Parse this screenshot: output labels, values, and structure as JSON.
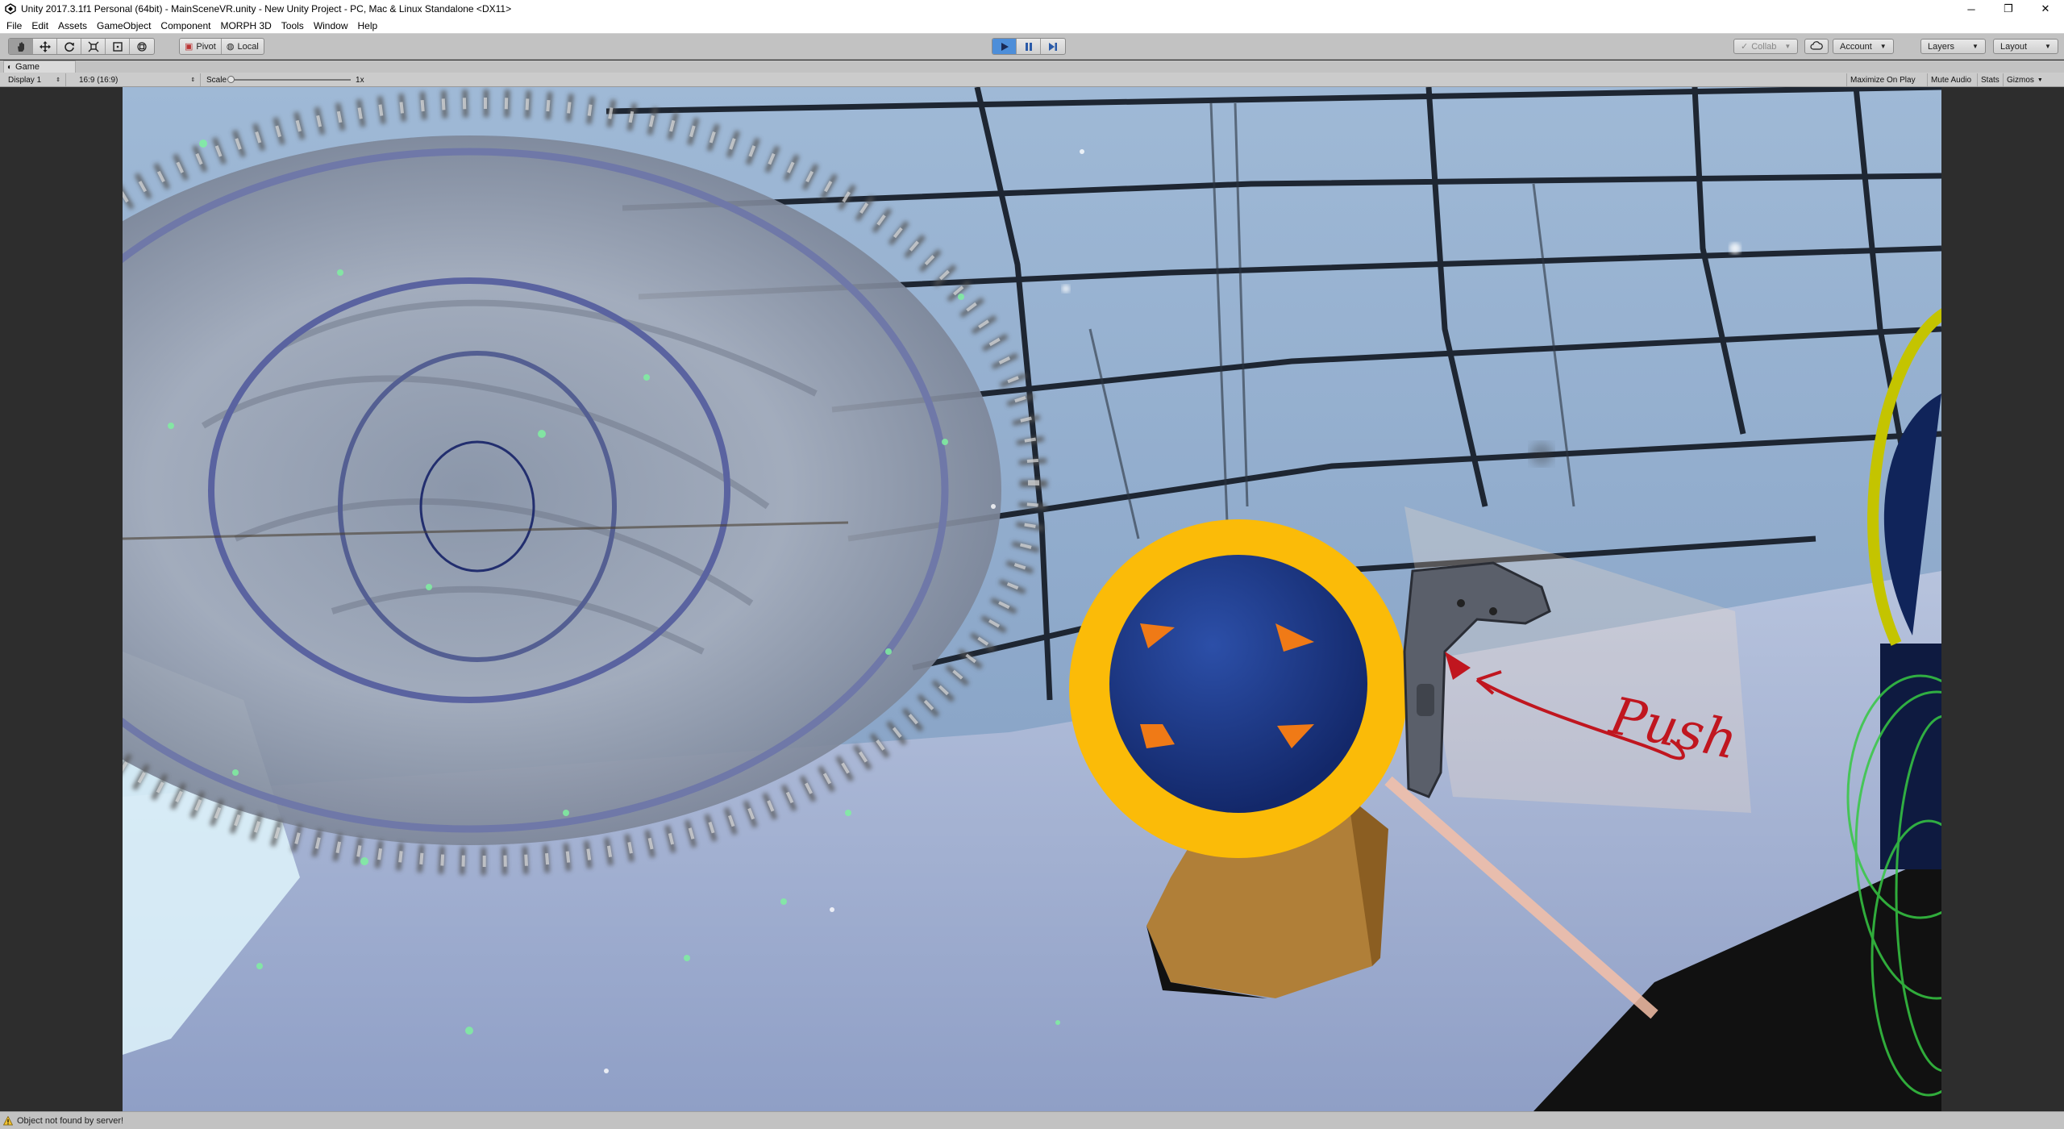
{
  "window": {
    "title": "Unity 2017.3.1f1 Personal (64bit) - MainSceneVR.unity - New Unity Project - PC, Mac & Linux Standalone <DX11>",
    "minimize": "─",
    "restore": "❐",
    "close": "✕"
  },
  "menu": [
    "File",
    "Edit",
    "Assets",
    "GameObject",
    "Component",
    "MORPH 3D",
    "Tools",
    "Window",
    "Help"
  ],
  "toolbar": {
    "pivot_label": "Pivot",
    "local_label": "Local",
    "collab_label": "Collab",
    "account_label": "Account",
    "layers_label": "Layers",
    "layout_label": "Layout"
  },
  "game_tab": {
    "label": "Game"
  },
  "game_controls": {
    "display": "Display 1",
    "aspect": "16:9 (16:9)",
    "scale_label": "Scale",
    "scale_value": "1x",
    "maximize_on_play": "Maximize On Play",
    "mute_audio": "Mute Audio",
    "stats": "Stats",
    "gizmos": "Gizmos"
  },
  "scene": {
    "annotation_text": "Push",
    "annotation_color": "#c0161f",
    "button_ring_color": "#fbbb08",
    "button_core_color": "#1e3a8a",
    "button_marker_color": "#f07a16"
  },
  "status": {
    "message": "Object not found by server!"
  },
  "colors": {
    "play_active": "#4d8ed9",
    "chrome": "#c2c2c2"
  }
}
